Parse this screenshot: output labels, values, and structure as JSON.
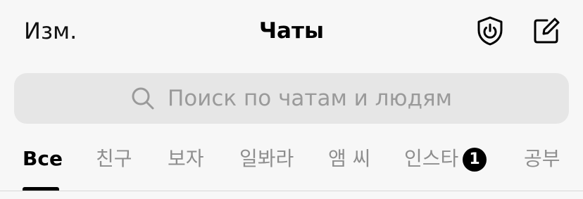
{
  "header": {
    "edit_label": "Изм.",
    "title": "Чаты"
  },
  "icons": {
    "shield": "shield-power-icon",
    "compose": "compose-icon",
    "search": "search-icon"
  },
  "search": {
    "placeholder": "Поиск по чатам и людям"
  },
  "tabs": [
    {
      "label": "Все",
      "active": true
    },
    {
      "label": "친구",
      "active": false
    },
    {
      "label": "보자",
      "active": false
    },
    {
      "label": "일봐라",
      "active": false
    },
    {
      "label": "앰 씨",
      "active": false
    },
    {
      "label": "인스타",
      "active": false,
      "badge": "1"
    },
    {
      "label": "공부",
      "active": false
    }
  ],
  "colors": {
    "background": "#f7f7f7",
    "search_bg": "#e6e6e6",
    "inactive_tab": "#8e8e8e",
    "active_tab": "#000000"
  }
}
